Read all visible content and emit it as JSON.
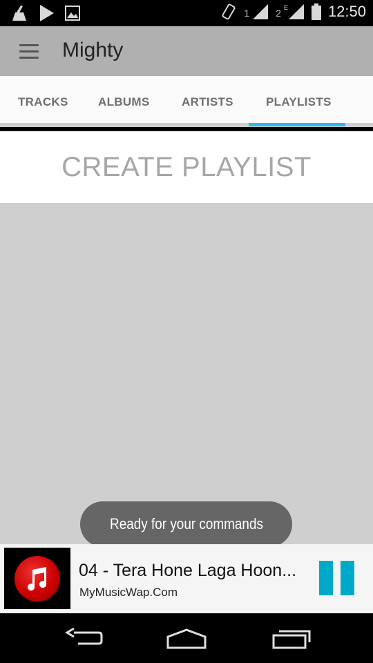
{
  "status_bar": {
    "sim1_label": "1",
    "sim2_label": "2",
    "clock": "12:50",
    "icons": [
      "cleaner-icon",
      "play-store-icon",
      "gallery-icon",
      "rotate-icon",
      "signal-icon",
      "signal-icon",
      "battery-icon"
    ]
  },
  "app_bar": {
    "title": "Mighty",
    "menu_icon": "hamburger-menu-icon"
  },
  "tabs": [
    {
      "label": "TRACKS",
      "selected": false
    },
    {
      "label": "ALBUMS",
      "selected": false
    },
    {
      "label": "ARTISTS",
      "selected": false
    },
    {
      "label": "PLAYLISTS",
      "selected": true
    }
  ],
  "playlist": {
    "create_label": "CREATE PLAYLIST"
  },
  "toast": {
    "message": "Ready for your commands"
  },
  "now_playing": {
    "title": "04 - Tera Hone Laga Hoon...",
    "artist": "MyMusicWap.Com",
    "album_art_icon": "music-note-icon",
    "control_icon": "pause-icon"
  },
  "nav_bar": {
    "icons": [
      "back-icon",
      "home-icon",
      "recents-icon"
    ]
  },
  "colors": {
    "accent": "#33b5e5",
    "pause": "#00a9c8",
    "app_bar": "#b0b0b0",
    "album_art": "#cc0000"
  }
}
